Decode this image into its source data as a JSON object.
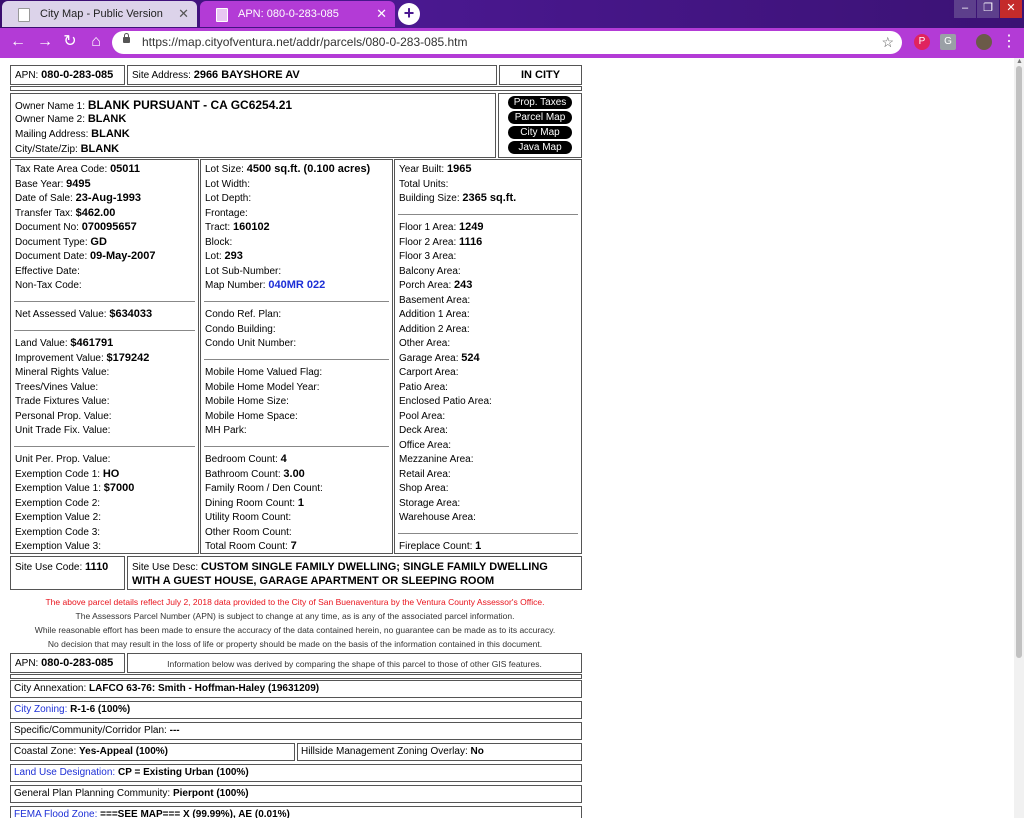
{
  "tabs": [
    {
      "title": "City Map - Public Version"
    },
    {
      "title": "APN: 080-0-283-085"
    }
  ],
  "url": "https://map.cityofventura.net/addr/parcels/080-0-283-085.htm",
  "header": {
    "apn_label": "APN:",
    "apn": "080-0-283-085",
    "site_address_label": "Site Address:",
    "site_address": "2966 BAYSHORE AV",
    "status": "IN CITY"
  },
  "owner": {
    "name1_label": "Owner Name 1:",
    "name1": "BLANK PURSUANT - CA GC6254.21",
    "name2_label": "Owner Name 2:",
    "name2": "BLANK",
    "mailing_label": "Mailing Address:",
    "mailing": "BLANK",
    "csz_label": "City/State/Zip:",
    "csz": "BLANK"
  },
  "buttons": [
    "Prop. Taxes",
    "Parcel Map",
    "City Map",
    "Java Map"
  ],
  "col1": [
    {
      "label": "Tax Rate Area Code:",
      "value": "05011"
    },
    {
      "label": "Base Year:",
      "value": "9495"
    },
    {
      "label": "Date of Sale:",
      "value": "23-Aug-1993"
    },
    {
      "label": "Transfer Tax:",
      "value": "$462.00"
    },
    {
      "label": "Document No:",
      "value": "070095657"
    },
    {
      "label": "Document Type:",
      "value": "GD"
    },
    {
      "label": "Document Date:",
      "value": "09-May-2007"
    },
    {
      "label": "Effective Date:",
      "value": ""
    },
    {
      "label": "Non-Tax Code:",
      "value": ""
    },
    {
      "label": "Net Assessed Value:",
      "value": "$634033"
    },
    {
      "label": "Land Value:",
      "value": "$461791"
    },
    {
      "label": "Improvement Value:",
      "value": "$179242"
    },
    {
      "label": "Mineral Rights Value:",
      "value": ""
    },
    {
      "label": "Trees/Vines Value:",
      "value": ""
    },
    {
      "label": "Trade Fixtures Value:",
      "value": ""
    },
    {
      "label": "Personal Prop. Value:",
      "value": ""
    },
    {
      "label": "Unit Trade Fix. Value:",
      "value": ""
    },
    {
      "label": "Unit Per. Prop. Value:",
      "value": ""
    },
    {
      "label": "Exemption Code 1:",
      "value": "HO"
    },
    {
      "label": "Exemption Value 1:",
      "value": "$7000"
    },
    {
      "label": "Exemption Code 2:",
      "value": ""
    },
    {
      "label": "Exemption Value 2:",
      "value": ""
    },
    {
      "label": "Exemption Code 3:",
      "value": ""
    },
    {
      "label": "Exemption Value 3:",
      "value": ""
    }
  ],
  "col2": [
    {
      "label": "Lot Size:",
      "value": "4500 sq.ft. (0.100 acres)"
    },
    {
      "label": "Lot Width:",
      "value": ""
    },
    {
      "label": "Lot Depth:",
      "value": ""
    },
    {
      "label": "Frontage:",
      "value": ""
    },
    {
      "label": "Tract:",
      "value": "160102"
    },
    {
      "label": "Block:",
      "value": ""
    },
    {
      "label": "Lot:",
      "value": "293"
    },
    {
      "label": "Lot Sub-Number:",
      "value": ""
    },
    {
      "label": "Map Number:",
      "value": "040MR 022"
    },
    {
      "label": "Condo Ref. Plan:",
      "value": ""
    },
    {
      "label": "Condo Building:",
      "value": ""
    },
    {
      "label": "Condo Unit Number:",
      "value": ""
    },
    {
      "label": "Mobile Home Valued Flag:",
      "value": ""
    },
    {
      "label": "Mobile Home Model Year:",
      "value": ""
    },
    {
      "label": "Mobile Home Size:",
      "value": ""
    },
    {
      "label": "Mobile Home Space:",
      "value": ""
    },
    {
      "label": "MH Park:",
      "value": ""
    },
    {
      "label": "Bedroom Count:",
      "value": "4"
    },
    {
      "label": "Bathroom Count:",
      "value": "3.00"
    },
    {
      "label": "Family Room / Den Count:",
      "value": ""
    },
    {
      "label": "Dining Room Count:",
      "value": "1"
    },
    {
      "label": "Utility Room Count:",
      "value": ""
    },
    {
      "label": "Other Room Count:",
      "value": ""
    },
    {
      "label": "Total Room Count:",
      "value": "7"
    }
  ],
  "col3": [
    {
      "label": "Year Built:",
      "value": "1965"
    },
    {
      "label": "Total Units:",
      "value": ""
    },
    {
      "label": "Building Size:",
      "value": "2365 sq.ft."
    },
    {
      "label": "Floor 1 Area:",
      "value": "1249"
    },
    {
      "label": "Floor 2 Area:",
      "value": "1116"
    },
    {
      "label": "Floor 3 Area:",
      "value": ""
    },
    {
      "label": "Balcony Area:",
      "value": ""
    },
    {
      "label": "Porch Area:",
      "value": "243"
    },
    {
      "label": "Basement Area:",
      "value": ""
    },
    {
      "label": "Addition 1 Area:",
      "value": ""
    },
    {
      "label": "Addition 2 Area:",
      "value": ""
    },
    {
      "label": "Other Area:",
      "value": ""
    },
    {
      "label": "Garage Area:",
      "value": "524"
    },
    {
      "label": "Carport Area:",
      "value": ""
    },
    {
      "label": "Patio Area:",
      "value": ""
    },
    {
      "label": "Enclosed Patio Area:",
      "value": ""
    },
    {
      "label": "Pool Area:",
      "value": ""
    },
    {
      "label": "Deck Area:",
      "value": ""
    },
    {
      "label": "Office Area:",
      "value": ""
    },
    {
      "label": "Mezzanine Area:",
      "value": ""
    },
    {
      "label": "Retail Area:",
      "value": ""
    },
    {
      "label": "Shop Area:",
      "value": ""
    },
    {
      "label": "Storage Area:",
      "value": ""
    },
    {
      "label": "Warehouse Area:",
      "value": ""
    },
    {
      "label": "Fireplace Count:",
      "value": "1"
    }
  ],
  "site_use": {
    "code_label": "Site Use Code:",
    "code": "1110",
    "desc_label": "Site Use Desc:",
    "desc_line1": "CUSTOM SINGLE FAMILY DWELLING; SINGLE FAMILY DWELLING",
    "desc_line2": "WITH A GUEST HOUSE, GARAGE APARTMENT OR SLEEPING ROOM"
  },
  "notes": [
    "The above parcel details reflect July 2, 2018 data provided to the City of San Buenaventura by the Ventura County Assessor's Office.",
    "The Assessors Parcel Number (APN) is subject to change at any time, as is any of the associated parcel information.",
    "While reasonable effort has been made to ensure the accuracy of the data contained herein, no guarantee can be made as to its accuracy.",
    "No decision that may result in the loss of life or property should be made on the basis of the information contained in this document."
  ],
  "gis": {
    "apn_label": "APN:",
    "apn": "080-0-283-085",
    "info": "Information below was derived by comparing the shape of this parcel to those of other GIS features.",
    "annexation_label": "City Annexation:",
    "annexation": "LAFCO 63-76: Smith - Hoffman-Haley (19631209)",
    "zoning_label": "City Zoning:",
    "zoning": "R-1-6 (100%)",
    "specific_label": "Specific/Community/Corridor Plan:",
    "specific": "---",
    "coastal_label": "Coastal Zone:",
    "coastal": "Yes-Appeal (100%)",
    "hillside_label": "Hillside Management Zoning Overlay:",
    "hillside": "No",
    "landuse_label": "Land Use Designation:",
    "landuse": "CP = Existing Urban (100%)",
    "gp_label": "General Plan Planning Community:",
    "gp": "Pierpont (100%)",
    "fema_label": "FEMA Flood Zone:",
    "fema": "===SEE MAP=== X (99.99%), AE (0.01%)"
  },
  "colors": {
    "link": "#1d2fd6",
    "note_red": "#e8141d",
    "chrome": "#b33bd6"
  }
}
